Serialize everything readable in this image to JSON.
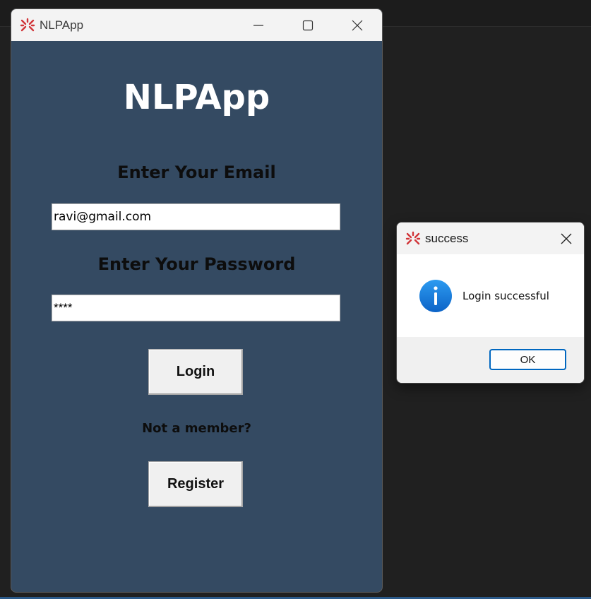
{
  "main_window": {
    "title": "NLPApp",
    "heading": "NLPApp",
    "email_label": "Enter Your Email",
    "email_value": "ravi@gmail.com",
    "password_label": "Enter Your Password",
    "password_value": "****",
    "login_label": "Login",
    "member_text": "Not a member?",
    "register_label": "Register",
    "icons": {
      "app": "feather-app-icon",
      "minimize": "minimize-icon",
      "maximize": "maximize-icon",
      "close": "close-icon"
    }
  },
  "dialog": {
    "title": "success",
    "message": "Login successful",
    "ok_label": "OK",
    "icons": {
      "app": "feather-app-icon",
      "info": "info-icon",
      "close": "close-icon"
    }
  },
  "colors": {
    "window_bg": "#344a62",
    "desktop_bg": "#202020",
    "accent": "#0067c0",
    "icon_red": "#d13438"
  }
}
